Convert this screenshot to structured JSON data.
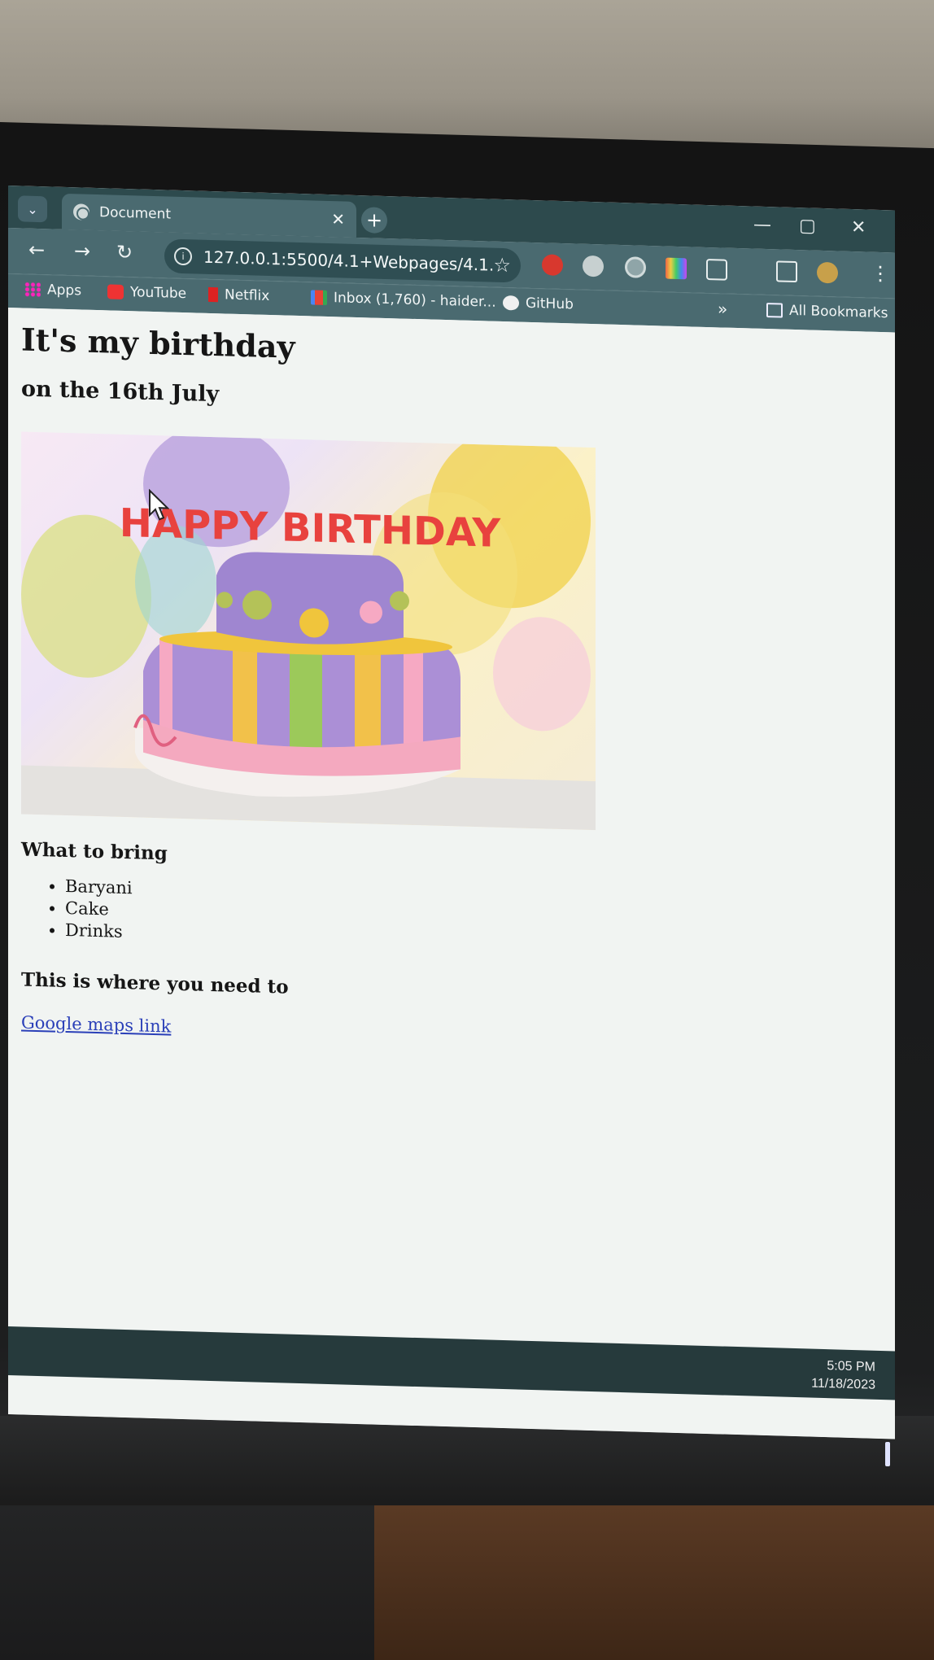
{
  "browser": {
    "tab_title": "Document",
    "url": "127.0.0.1:5500/4.1+Webpages/4.1...",
    "bookmarks": [
      "Apps",
      "YouTube",
      "Netflix",
      "Inbox (1,760) - haider...",
      "GitHub"
    ],
    "all_bookmarks": "All Bookmarks",
    "overflow": "»"
  },
  "page": {
    "heading": "It's my birthday",
    "subheading": "on the 16th July",
    "image_text": "HAPPY BIRTHDAY",
    "bring_heading": "What to bring",
    "bring_items": [
      "Baryani",
      "Cake",
      "Drinks"
    ],
    "where_heading": "This is where you need to",
    "map_link": "Google maps link"
  },
  "taskbar": {
    "time": "5:05 PM",
    "date": "11/18/2023"
  },
  "colors": {
    "chrome_frame": "#2d4a4d",
    "chrome_toolbar": "#4a6a70",
    "link": "#2a3fb8"
  }
}
